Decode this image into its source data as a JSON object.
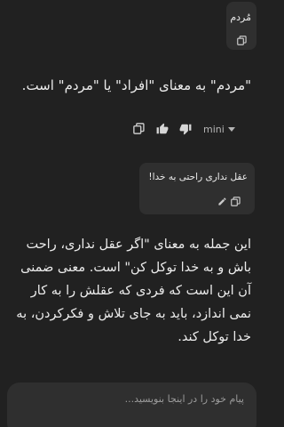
{
  "messages": {
    "user1": "مُردم",
    "assistant1": "\"مردم\" به معنای \"افراد\" یا \"مردم\" است.",
    "user2": "عقل نداری راحتی به خدا!",
    "assistant2": "این جمله به معنای \"اگر عقل نداری، راحت باش و به خدا توکل کن\" است. معنی ضمنی آن این است که فردی که عقلش را به کار نمی اندازد، باید به جای تلاش و فکرکردن، به خدا توکل کند."
  },
  "actions": {
    "model_label": "mini"
  },
  "composer": {
    "placeholder": "پیام خود را در اینجا بنویسید..."
  },
  "icons": [
    "copy-icon",
    "thumbs-up-icon",
    "thumbs-down-icon",
    "edit-icon",
    "chevron-down-icon"
  ],
  "colors": {
    "background": "#212121",
    "bubble": "#2f2f2f",
    "text": "#ececec",
    "muted": "#b4b4b4"
  }
}
